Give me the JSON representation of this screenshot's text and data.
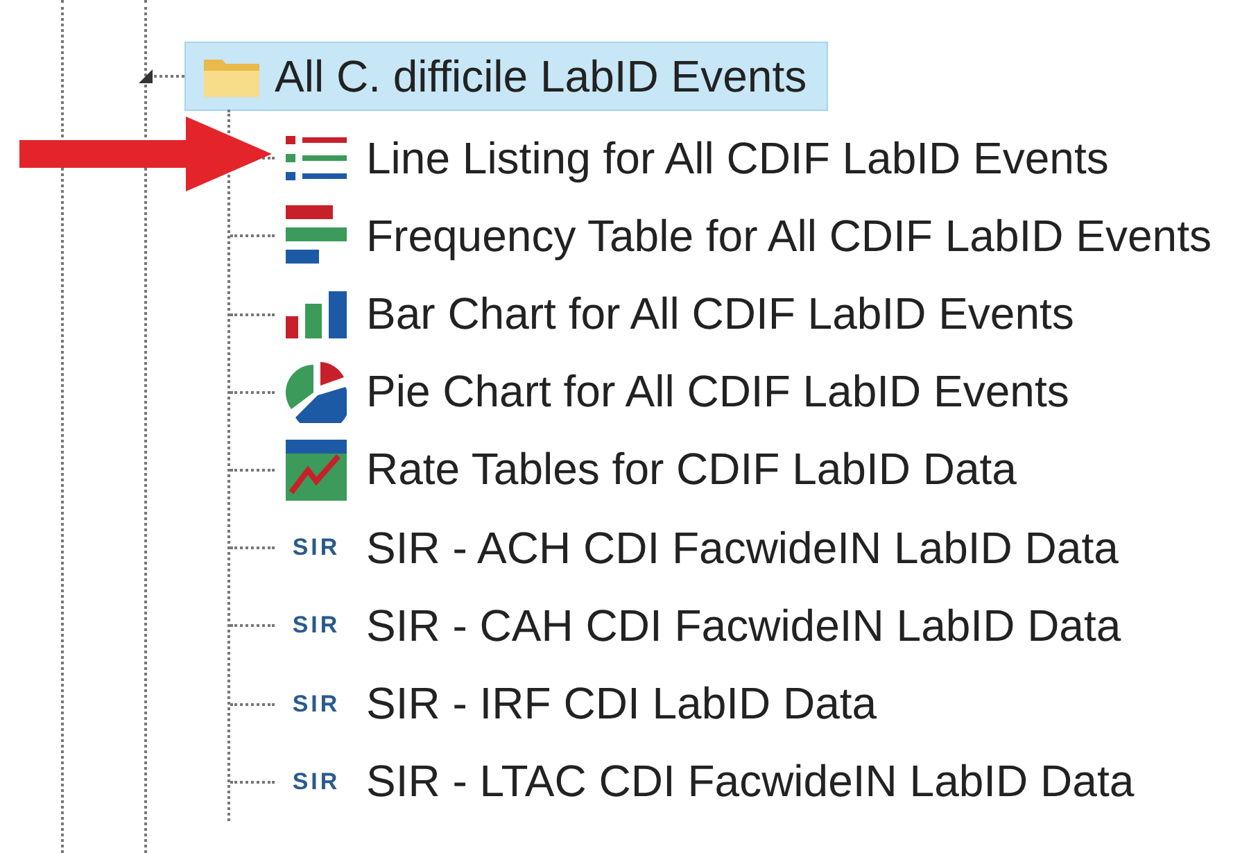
{
  "tree": {
    "folder": {
      "label": "All C. difficile LabID Events",
      "expanded": true,
      "selected": true
    },
    "children": [
      {
        "kind": "line_listing",
        "label": "Line Listing for All CDIF LabID Events",
        "selected": false
      },
      {
        "kind": "frequency_table",
        "label": "Frequency Table for All CDIF LabID Events",
        "selected": false
      },
      {
        "kind": "bar_chart",
        "label": "Bar Chart for All CDIF LabID Events",
        "selected": false
      },
      {
        "kind": "pie_chart",
        "label": "Pie Chart for All CDIF LabID Events",
        "selected": false
      },
      {
        "kind": "rate_table",
        "label": "Rate Tables for CDIF LabID Data",
        "selected": false
      },
      {
        "kind": "sir",
        "badge": "SIR",
        "label": "SIR - ACH CDI FacwideIN LabID Data",
        "selected": false
      },
      {
        "kind": "sir",
        "badge": "SIR",
        "label": "SIR - CAH CDI FacwideIN LabID Data",
        "selected": false
      },
      {
        "kind": "sir",
        "badge": "SIR",
        "label": "SIR - IRF CDI LabID Data",
        "selected": false
      },
      {
        "kind": "sir",
        "badge": "SIR",
        "label": "SIR - LTAC CDI FacwideIN LabID Data",
        "selected": false
      }
    ]
  },
  "callout": {
    "kind": "arrow"
  }
}
